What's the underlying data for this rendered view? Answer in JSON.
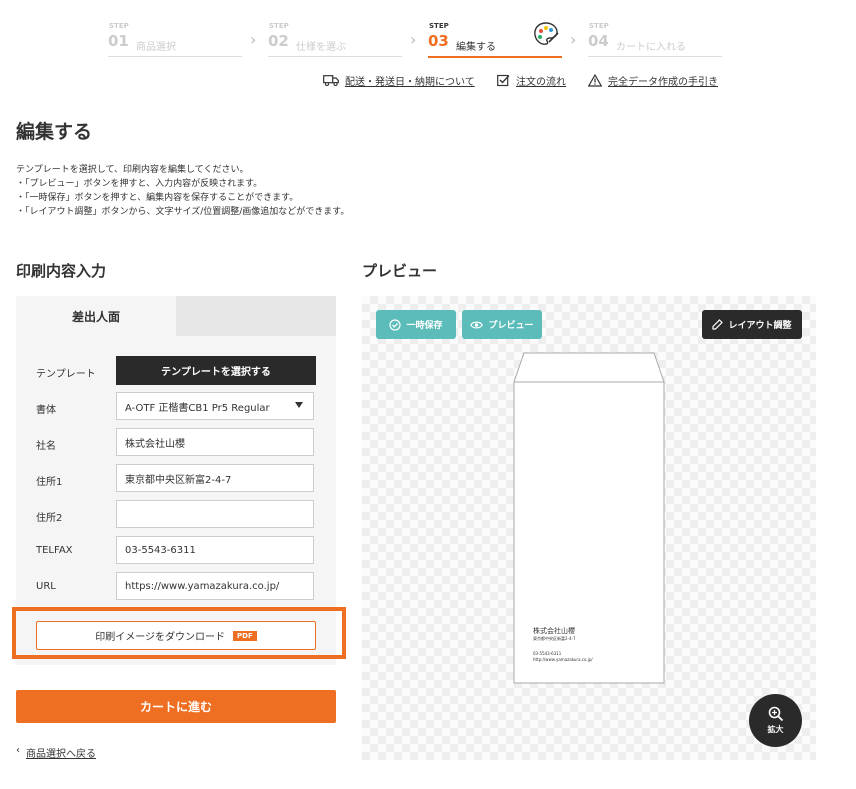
{
  "steps": [
    {
      "label": "STEP",
      "num": "01",
      "name": "商品選択"
    },
    {
      "label": "STEP",
      "num": "02",
      "name": "仕様を選ぶ"
    },
    {
      "label": "STEP",
      "num": "03",
      "name": "編集する"
    },
    {
      "label": "STEP",
      "num": "04",
      "name": "カートに入れる"
    }
  ],
  "top_links": {
    "shipping": "配送・発送日・納期について",
    "order_flow": "注文の流れ",
    "data_guide": "完全データ作成の手引き"
  },
  "page_title": "編集する",
  "intro": [
    "テンプレートを選択して、印刷内容を編集してください。",
    "・「プレビュー」ボタンを押すと、入力内容が反映されます。",
    "・「一時保存」ボタンを押すと、編集内容を保存することができます。",
    "・「レイアウト調整」ボタンから、文字サイズ/位置調整/画像追加などができます。"
  ],
  "input_section": {
    "title": "印刷内容入力",
    "tab_label": "差出人面",
    "template_label": "テンプレート",
    "template_button": "テンプレートを選択する",
    "font_label": "書体",
    "font_value": "A-OTF 正楷書CB1 Pr5 Regular",
    "company_label": "社名",
    "company_value": "株式会社山櫻",
    "address1_label": "住所1",
    "address1_value": "東京都中央区新富2-4-7",
    "address2_label": "住所2",
    "address2_value": "",
    "telfax_label": "TELFAX",
    "telfax_value": "03-5543-6311",
    "url_label": "URL",
    "url_value": "https://www.yamazakura.co.jp/",
    "download_button": "印刷イメージをダウンロード",
    "pdf_badge": "PDF",
    "accent_color": "#ee6f22"
  },
  "cart_button": "カートに進む",
  "back_link": "商品選択へ戻る",
  "preview": {
    "title": "プレビュー",
    "save_button": "一時保存",
    "preview_button": "プレビュー",
    "layout_button": "レイアウト調整",
    "zoom_button": "拡大",
    "envelope": {
      "company": "株式会社山櫻",
      "address": "東京都中央区新富2-4-7",
      "tel": "03-5543-6311",
      "url": "http://www.yamazakura.co.jp/"
    },
    "teal_color": "#5bbcb9"
  }
}
